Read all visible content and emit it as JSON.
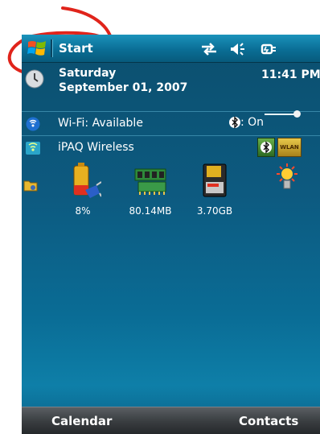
{
  "taskbar": {
    "start_label": "Start"
  },
  "today": {
    "day": "Saturday",
    "date": "September 01, 2007",
    "time": "11:41 PM"
  },
  "wifi": {
    "label": "Wi-Fi: Available",
    "bluetooth_status": ": On"
  },
  "ipaq": {
    "label": "iPAQ Wireless",
    "wlan_button": "WLAN"
  },
  "resources": {
    "battery": "8%",
    "memory": "80.14MB",
    "storage": "3.70GB"
  },
  "softkeys": {
    "left": "Calendar",
    "right": "Contacts"
  },
  "colors": {
    "annotation": "#e0241b",
    "background": "#0d5a80"
  },
  "icons": [
    "windows-logo-icon",
    "connectivity-icon",
    "volume-icon",
    "power-icon",
    "clock-icon",
    "wifi-icon",
    "bluetooth-icon",
    "ipaq-wireless-icon",
    "folder-icon",
    "battery-icon",
    "memory-icon",
    "storage-icon",
    "brightness-icon"
  ]
}
